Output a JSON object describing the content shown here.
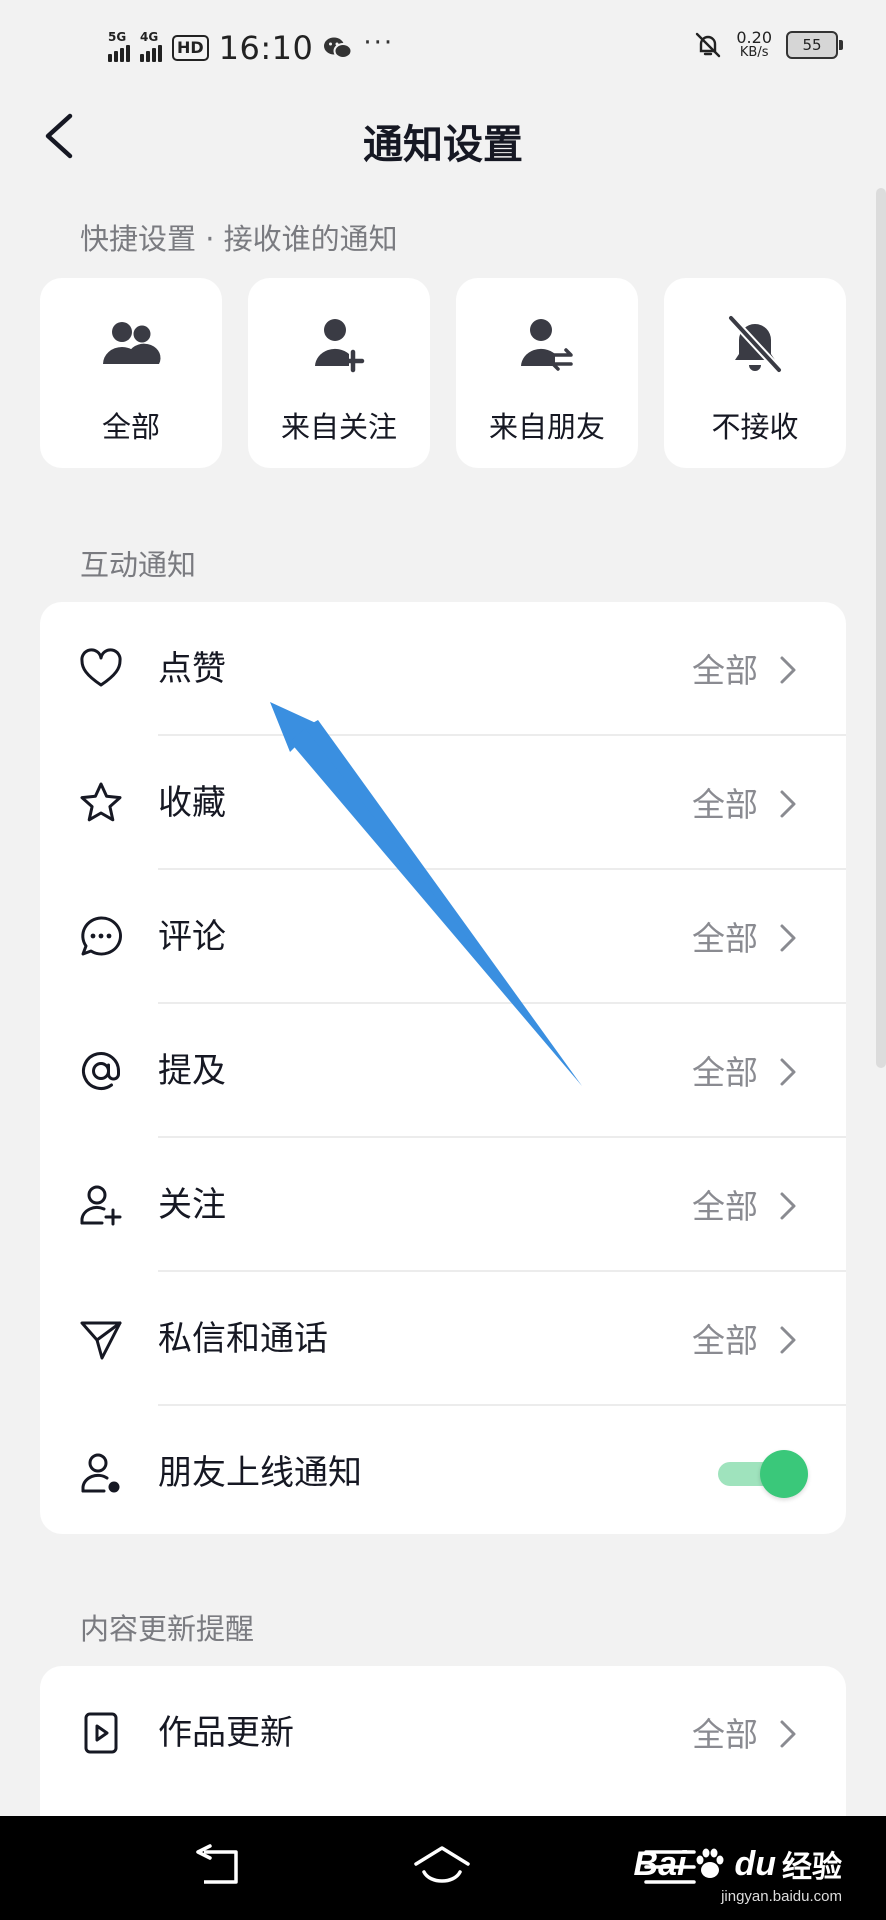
{
  "status_bar": {
    "signal_1": "5G",
    "signal_2": "4G",
    "hd": "HD",
    "time": "16:10",
    "more": "···",
    "speed_value": "0.20",
    "speed_unit": "KB/s",
    "battery": "55"
  },
  "header": {
    "title": "通知设置"
  },
  "quick_settings": {
    "label": "快捷设置 · 接收谁的通知",
    "cards": [
      {
        "label": "全部",
        "icon": "people-icon"
      },
      {
        "label": "来自关注",
        "icon": "user-add-icon"
      },
      {
        "label": "来自朋友",
        "icon": "user-swap-icon"
      },
      {
        "label": "不接收",
        "icon": "bell-off-icon"
      }
    ]
  },
  "interaction": {
    "label": "互动通知",
    "rows": [
      {
        "label": "点赞",
        "value": "全部",
        "icon": "heart-icon"
      },
      {
        "label": "收藏",
        "value": "全部",
        "icon": "star-icon"
      },
      {
        "label": "评论",
        "value": "全部",
        "icon": "comment-icon"
      },
      {
        "label": "提及",
        "value": "全部",
        "icon": "at-icon"
      },
      {
        "label": "关注",
        "value": "全部",
        "icon": "user-plus-icon"
      },
      {
        "label": "私信和通话",
        "value": "全部",
        "icon": "send-icon"
      },
      {
        "label": "朋友上线通知",
        "icon": "user-online-icon",
        "toggle_on": true
      }
    ]
  },
  "content_updates": {
    "label": "内容更新提醒",
    "rows": [
      {
        "label": "作品更新",
        "value": "全部",
        "icon": "video-icon"
      }
    ]
  },
  "watermark": {
    "bai": "Bai",
    "du": "du",
    "jingyan": "经验",
    "url": "jingyan.baidu.com"
  },
  "colors": {
    "background": "#f2f2f2",
    "card": "#ffffff",
    "toggle_on": "#3ac87a",
    "annotation_arrow": "#3a8fe0"
  }
}
